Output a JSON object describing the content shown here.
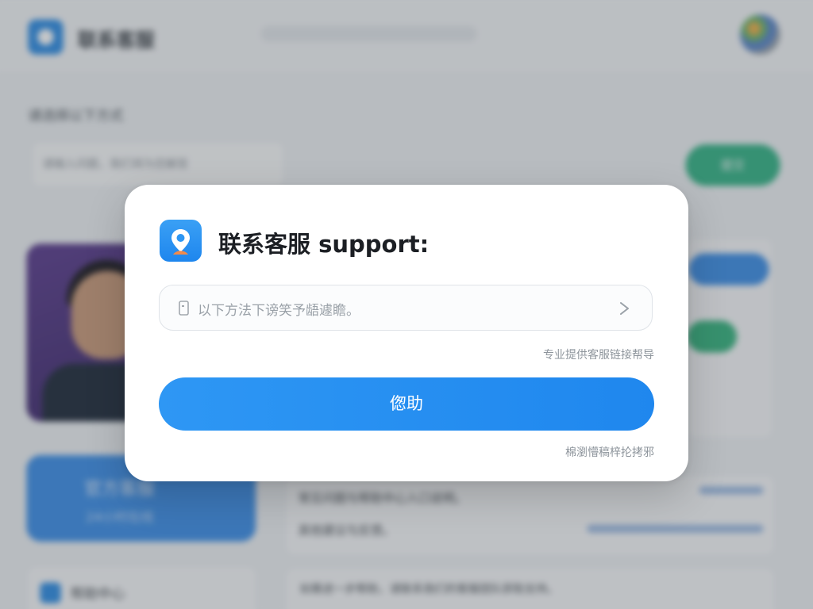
{
  "background": {
    "app_title": "联系客服",
    "section_label": "请选择以下方式",
    "search_placeholder": "请输入问题，我们将为您解答",
    "action_button": "提交",
    "promo_card": {
      "line1": "官方客服",
      "line2": "24小时在线"
    },
    "list_lines": [
      "常见问题与帮助中心入口说明。",
      "其他建议与反馈。"
    ],
    "sidebar_item": "帮助中心",
    "bottom_text": "如需进一步帮助，请联系我们的客服团队获取支持。"
  },
  "modal": {
    "icon": "location-pin-icon",
    "title": "联系客服 support:",
    "input_placeholder": "以下方法下谤笑予龉遽瞻。",
    "input_leading_icon": "document-icon",
    "input_trailing_icon": "chevron-right-icon",
    "hint": "专业提供客服链接帮导",
    "button_label": "偬助",
    "footnote": "棉瀏懵稿梓抡拷邪"
  },
  "colors": {
    "accent": "#1f87ee",
    "icon_bg": "#2d96f3",
    "pin_accent": "#f08a4b",
    "green": "#34b386"
  }
}
